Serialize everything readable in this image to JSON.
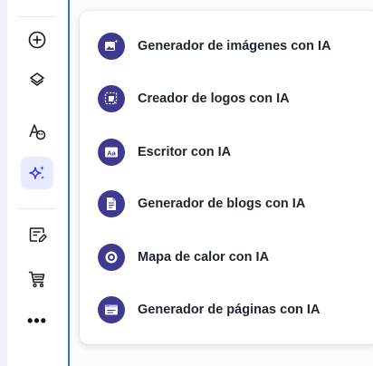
{
  "sidebar": {
    "items": [
      {
        "icon": "add-circle-icon"
      },
      {
        "icon": "layers-icon"
      },
      {
        "icon": "typography-palette-icon"
      },
      {
        "icon": "ai-sparkle-icon",
        "active": true
      },
      {
        "icon": "edit-note-icon"
      },
      {
        "icon": "shopping-cart-icon"
      },
      {
        "icon": "more-icon",
        "label": "•••"
      }
    ]
  },
  "ai_menu": {
    "items": [
      {
        "label": "Generador de imágenes con IA",
        "icon": "image-generator-icon"
      },
      {
        "label": "Creador de logos con IA",
        "icon": "logo-creator-icon"
      },
      {
        "label": "Escritor con IA",
        "icon": "text-writer-icon"
      },
      {
        "label": "Generador de blogs con IA",
        "icon": "blog-generator-icon"
      },
      {
        "label": "Mapa de calor con IA",
        "icon": "heatmap-icon"
      },
      {
        "label": "Generador de páginas con IA",
        "icon": "page-generator-icon"
      }
    ]
  },
  "colors": {
    "accent": "#3b6ef0",
    "icon_bg": "#3d3a8f",
    "active_bg": "#e8ebff"
  }
}
